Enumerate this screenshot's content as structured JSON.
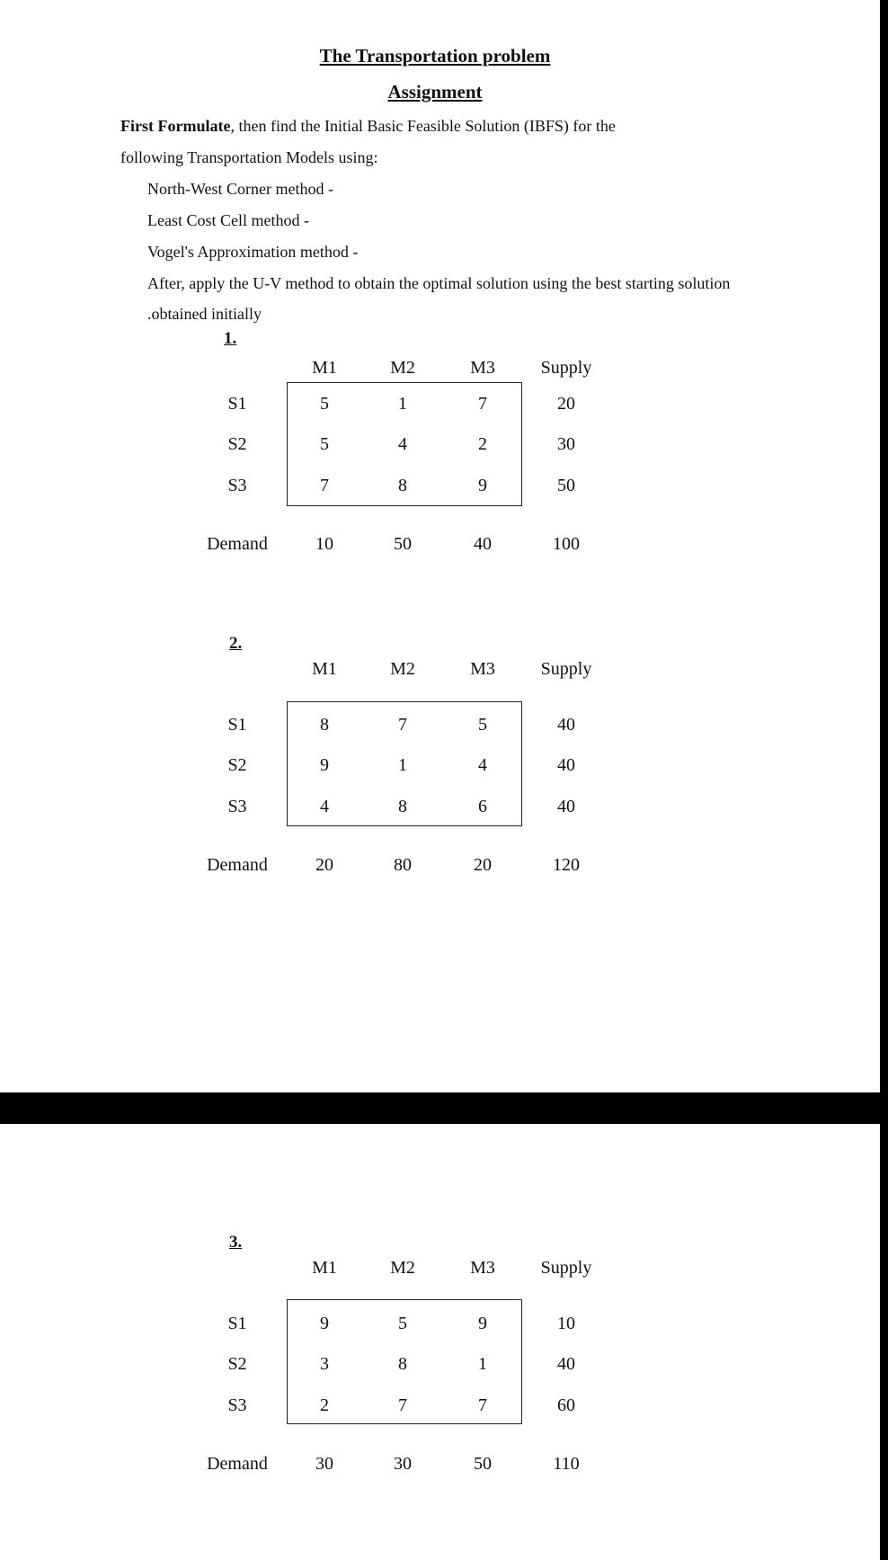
{
  "document": {
    "title": "The Transportation problem",
    "subtitle": "Assignment",
    "intro_bold": "First Formulate",
    "intro_rest": ", then find the Initial Basic Feasible Solution (IBFS) for the",
    "intro_line2": "following Transportation Models using:",
    "methods": [
      "North-West Corner method -",
      "Least Cost Cell method -",
      "Vogel's Approximation method -"
    ],
    "after_line1": "After, apply the U-V method to obtain the optimal solution using the best starting solution",
    "after_line2": ".obtained initially"
  },
  "problems": [
    {
      "number": "1.",
      "columns": [
        "M1",
        "M2",
        "M3",
        "Supply"
      ],
      "rows": [
        {
          "label": "S1",
          "costs": [
            "5",
            "1",
            "7"
          ],
          "supply": "20"
        },
        {
          "label": "S2",
          "costs": [
            "5",
            "4",
            "2"
          ],
          "supply": "30"
        },
        {
          "label": "S3",
          "costs": [
            "7",
            "8",
            "9"
          ],
          "supply": "50"
        }
      ],
      "demand_label": "Demand",
      "demand": [
        "10",
        "50",
        "40"
      ],
      "total": "100"
    },
    {
      "number": "2.",
      "columns": [
        "M1",
        "M2",
        "M3",
        "Supply"
      ],
      "rows": [
        {
          "label": "S1",
          "costs": [
            "8",
            "7",
            "5"
          ],
          "supply": "40"
        },
        {
          "label": "S2",
          "costs": [
            "9",
            "1",
            "4"
          ],
          "supply": "40"
        },
        {
          "label": "S3",
          "costs": [
            "4",
            "8",
            "6"
          ],
          "supply": "40"
        }
      ],
      "demand_label": "Demand",
      "demand": [
        "20",
        "80",
        "20"
      ],
      "total": "120"
    },
    {
      "number": "3.",
      "columns": [
        "M1",
        "M2",
        "M3",
        "Supply"
      ],
      "rows": [
        {
          "label": "S1",
          "costs": [
            "9",
            "5",
            "9"
          ],
          "supply": "10"
        },
        {
          "label": "S2",
          "costs": [
            "3",
            "8",
            "1"
          ],
          "supply": "40"
        },
        {
          "label": "S3",
          "costs": [
            "2",
            "7",
            "7"
          ],
          "supply": "60"
        }
      ],
      "demand_label": "Demand",
      "demand": [
        "30",
        "30",
        "50"
      ],
      "total": "110"
    }
  ]
}
